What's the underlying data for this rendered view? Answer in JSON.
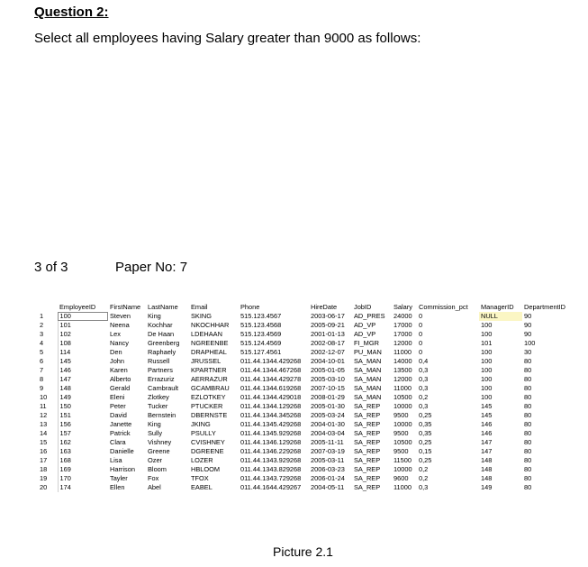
{
  "question": {
    "title": "Question 2:",
    "text": "Select all employees having Salary greater than 9000 as follows:"
  },
  "footer": {
    "page_info": "3 of 3",
    "paper_no": "Paper No: 7"
  },
  "result_grid": {
    "columns": [
      "EmployeeID",
      "FirstName",
      "LastName",
      "Email",
      "Phone",
      "HireDate",
      "JobID",
      "Salary",
      "Commission_pct",
      "ManagerID",
      "DepartmentID"
    ],
    "rows": [
      [
        "1",
        "100",
        "Steven",
        "King",
        "SKING",
        "515.123.4567",
        "2003-06-17",
        "AD_PRES",
        "24000",
        "0",
        "NULL",
        "90"
      ],
      [
        "2",
        "101",
        "Neena",
        "Kochhar",
        "NKOCHHAR",
        "515.123.4568",
        "2005-09-21",
        "AD_VP",
        "17000",
        "0",
        "100",
        "90"
      ],
      [
        "3",
        "102",
        "Lex",
        "De Haan",
        "LDEHAAN",
        "515.123.4569",
        "2001-01-13",
        "AD_VP",
        "17000",
        "0",
        "100",
        "90"
      ],
      [
        "4",
        "108",
        "Nancy",
        "Greenberg",
        "NGREENBE",
        "515.124.4569",
        "2002-08-17",
        "FI_MGR",
        "12000",
        "0",
        "101",
        "100"
      ],
      [
        "5",
        "114",
        "Den",
        "Raphaely",
        "DRAPHEAL",
        "515.127.4561",
        "2002-12-07",
        "PU_MAN",
        "11000",
        "0",
        "100",
        "30"
      ],
      [
        "6",
        "145",
        "John",
        "Russell",
        "JRUSSEL",
        "011.44.1344.429268",
        "2004-10-01",
        "SA_MAN",
        "14000",
        "0,4",
        "100",
        "80"
      ],
      [
        "7",
        "146",
        "Karen",
        "Partners",
        "KPARTNER",
        "011.44.1344.467268",
        "2005-01-05",
        "SA_MAN",
        "13500",
        "0,3",
        "100",
        "80"
      ],
      [
        "8",
        "147",
        "Alberto",
        "Errazuriz",
        "AERRAZUR",
        "011.44.1344.429278",
        "2005-03-10",
        "SA_MAN",
        "12000",
        "0,3",
        "100",
        "80"
      ],
      [
        "9",
        "148",
        "Gerald",
        "Cambrault",
        "GCAMBRAU",
        "011.44.1344.619268",
        "2007-10-15",
        "SA_MAN",
        "11000",
        "0,3",
        "100",
        "80"
      ],
      [
        "10",
        "149",
        "Eleni",
        "Zlotkey",
        "EZLOTKEY",
        "011.44.1344.429018",
        "2008-01-29",
        "SA_MAN",
        "10500",
        "0,2",
        "100",
        "80"
      ],
      [
        "11",
        "150",
        "Peter",
        "Tucker",
        "PTUCKER",
        "011.44.1344.129268",
        "2005-01-30",
        "SA_REP",
        "10000",
        "0,3",
        "145",
        "80"
      ],
      [
        "12",
        "151",
        "David",
        "Bernstein",
        "DBERNSTE",
        "011.44.1344.345268",
        "2005-03-24",
        "SA_REP",
        "9500",
        "0,25",
        "145",
        "80"
      ],
      [
        "13",
        "156",
        "Janette",
        "King",
        "JKING",
        "011.44.1345.429268",
        "2004-01-30",
        "SA_REP",
        "10000",
        "0,35",
        "146",
        "80"
      ],
      [
        "14",
        "157",
        "Patrick",
        "Sully",
        "PSULLY",
        "011.44.1345.929268",
        "2004-03-04",
        "SA_REP",
        "9500",
        "0,35",
        "146",
        "80"
      ],
      [
        "15",
        "162",
        "Clara",
        "Vishney",
        "CVISHNEY",
        "011.44.1346.129268",
        "2005-11-11",
        "SA_REP",
        "10500",
        "0,25",
        "147",
        "80"
      ],
      [
        "16",
        "163",
        "Danielle",
        "Greene",
        "DGREENE",
        "011.44.1346.229268",
        "2007-03-19",
        "SA_REP",
        "9500",
        "0,15",
        "147",
        "80"
      ],
      [
        "17",
        "168",
        "Lisa",
        "Ozer",
        "LOZER",
        "011.44.1343.929268",
        "2005-03-11",
        "SA_REP",
        "11500",
        "0,25",
        "148",
        "80"
      ],
      [
        "18",
        "169",
        "Harrison",
        "Bloom",
        "HBLOOM",
        "011.44.1343.829268",
        "2006-03-23",
        "SA_REP",
        "10000",
        "0,2",
        "148",
        "80"
      ],
      [
        "19",
        "170",
        "Tayler",
        "Fox",
        "TFOX",
        "011.44.1343.729268",
        "2006-01-24",
        "SA_REP",
        "9600",
        "0,2",
        "148",
        "80"
      ],
      [
        "20",
        "174",
        "Ellen",
        "Abel",
        "EABEL",
        "011.44.1644.429267",
        "2004-05-11",
        "SA_REP",
        "11000",
        "0,3",
        "149",
        "80"
      ]
    ]
  },
  "caption": "Picture 2.1"
}
